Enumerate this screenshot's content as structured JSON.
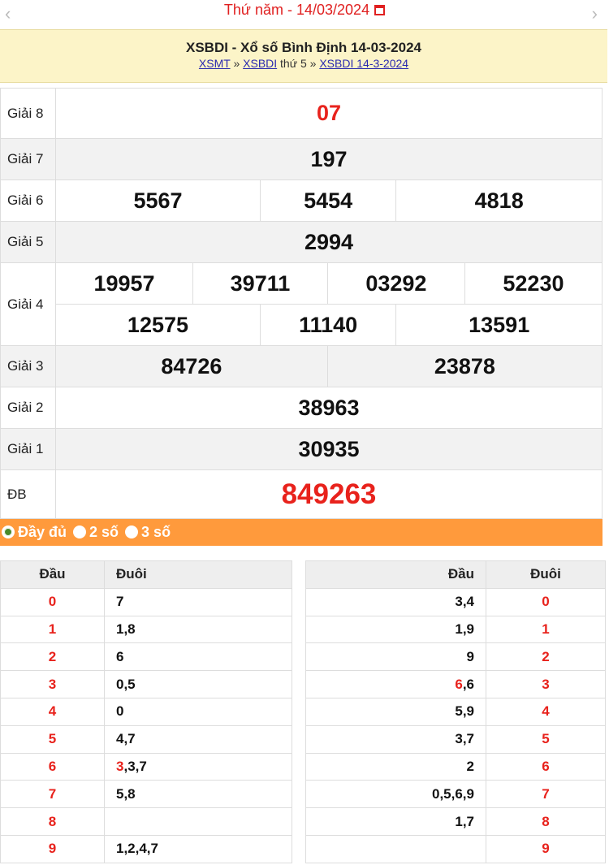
{
  "date_bar": {
    "label": "Thứ năm -  14/03/2024",
    "prev": "‹",
    "next": "›"
  },
  "heading": {
    "title": "XSBDI - Xổ số Bình Định 14-03-2024",
    "crumbs": [
      {
        "text": "XSMT",
        "link": true
      },
      {
        "text": " » ",
        "link": false
      },
      {
        "text": "XSBDI",
        "link": true
      },
      {
        "text": " thứ 5 » ",
        "link": false
      },
      {
        "text": "XSBDI 14-3-2024",
        "link": true
      }
    ]
  },
  "prizes": [
    {
      "label": "Giải 8",
      "rows": [
        [
          "07"
        ]
      ],
      "style": "red"
    },
    {
      "label": "Giải 7",
      "rows": [
        [
          "197"
        ]
      ]
    },
    {
      "label": "Giải 6",
      "rows": [
        [
          "5567",
          "5454",
          "4818"
        ]
      ]
    },
    {
      "label": "Giải 5",
      "rows": [
        [
          "2994"
        ]
      ]
    },
    {
      "label": "Giải 4",
      "rows": [
        [
          "19957",
          "39711",
          "03292",
          "52230"
        ],
        [
          "12575",
          "11140",
          "13591"
        ]
      ]
    },
    {
      "label": "Giải 3",
      "rows": [
        [
          "84726",
          "23878"
        ]
      ]
    },
    {
      "label": "Giải 2",
      "rows": [
        [
          "38963"
        ]
      ]
    },
    {
      "label": "Giải 1",
      "rows": [
        [
          "30935"
        ]
      ]
    },
    {
      "label": "ĐB",
      "rows": [
        [
          "849263"
        ]
      ],
      "style": "big-red"
    }
  ],
  "options": [
    {
      "label": "Đầy đủ",
      "selected": true
    },
    {
      "label": "2 số",
      "selected": false
    },
    {
      "label": "3 số",
      "selected": false
    }
  ],
  "loto_left": {
    "headers": [
      "Đầu",
      "Đuôi"
    ],
    "rows": [
      {
        "head": "0",
        "tail": [
          {
            "t": "7"
          }
        ]
      },
      {
        "head": "1",
        "tail": [
          {
            "t": "1,8"
          }
        ]
      },
      {
        "head": "2",
        "tail": [
          {
            "t": "6"
          }
        ]
      },
      {
        "head": "3",
        "tail": [
          {
            "t": "0,5"
          }
        ]
      },
      {
        "head": "4",
        "tail": [
          {
            "t": "0"
          }
        ]
      },
      {
        "head": "5",
        "tail": [
          {
            "t": "4,7"
          }
        ]
      },
      {
        "head": "6",
        "tail": [
          {
            "t": "3",
            "red": true
          },
          {
            "t": ",3,7"
          }
        ]
      },
      {
        "head": "7",
        "tail": [
          {
            "t": "5,8"
          }
        ]
      },
      {
        "head": "8",
        "tail": [
          {
            "t": ""
          }
        ]
      },
      {
        "head": "9",
        "tail": [
          {
            "t": "1,2,4,7"
          }
        ]
      }
    ]
  },
  "loto_right": {
    "headers": [
      "Đầu",
      "Đuôi"
    ],
    "rows": [
      {
        "head": [
          {
            "t": "3,4"
          }
        ],
        "tail": "0"
      },
      {
        "head": [
          {
            "t": "1,9"
          }
        ],
        "tail": "1"
      },
      {
        "head": [
          {
            "t": "9"
          }
        ],
        "tail": "2"
      },
      {
        "head": [
          {
            "t": "6",
            "red": true
          },
          {
            "t": ",6"
          }
        ],
        "tail": "3"
      },
      {
        "head": [
          {
            "t": "5,9"
          }
        ],
        "tail": "4"
      },
      {
        "head": [
          {
            "t": "3,7"
          }
        ],
        "tail": "5"
      },
      {
        "head": [
          {
            "t": "2"
          }
        ],
        "tail": "6"
      },
      {
        "head": [
          {
            "t": "0,5,6,9"
          }
        ],
        "tail": "7"
      },
      {
        "head": [
          {
            "t": "1,7"
          }
        ],
        "tail": "8"
      },
      {
        "head": [
          {
            "t": ""
          }
        ],
        "tail": "9"
      }
    ]
  }
}
